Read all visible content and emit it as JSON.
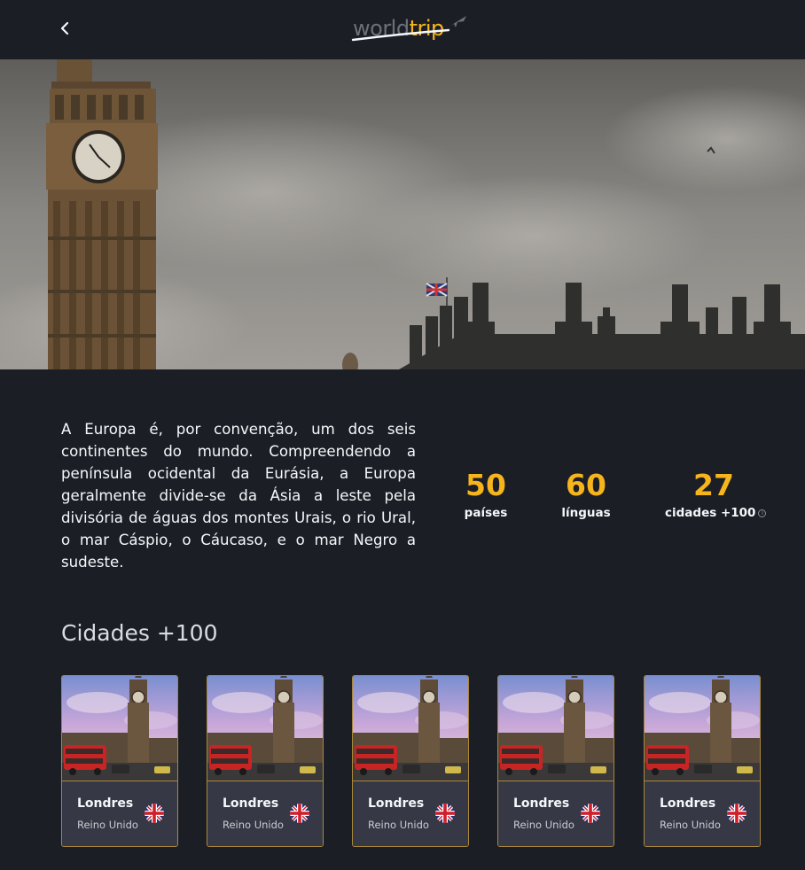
{
  "header": {
    "back_label": "Voltar",
    "logo_world": "world",
    "logo_trip": "trip",
    "logo_icon": "airplane-icon"
  },
  "continent": {
    "description": "A Europa é, por convenção, um dos seis continentes do mundo. Compreendendo a península ocidental da Eurásia, a Europa geralmente divide-se da Ásia a leste pela divisória de águas dos montes Urais, o rio Ural, o mar Cáspio, o Cáucaso, e o mar Negro a sudeste."
  },
  "stats": [
    {
      "value": "50",
      "label": "países"
    },
    {
      "value": "60",
      "label": "línguas"
    },
    {
      "value": "27",
      "label": "cidades +100",
      "info_icon": "info-icon"
    }
  ],
  "cities": {
    "title": "Cidades +100",
    "items": [
      {
        "name": "Londres",
        "country": "Reino Unido",
        "flag": "uk-flag-icon"
      },
      {
        "name": "Londres",
        "country": "Reino Unido",
        "flag": "uk-flag-icon"
      },
      {
        "name": "Londres",
        "country": "Reino Unido",
        "flag": "uk-flag-icon"
      },
      {
        "name": "Londres",
        "country": "Reino Unido",
        "flag": "uk-flag-icon"
      },
      {
        "name": "Londres",
        "country": "Reino Unido",
        "flag": "uk-flag-icon"
      }
    ]
  },
  "colors": {
    "background": "#1c1e26",
    "accent": "#f7b51c",
    "text": "#f5f8fa",
    "card_body": "#363945",
    "card_border": "#a9873a"
  }
}
